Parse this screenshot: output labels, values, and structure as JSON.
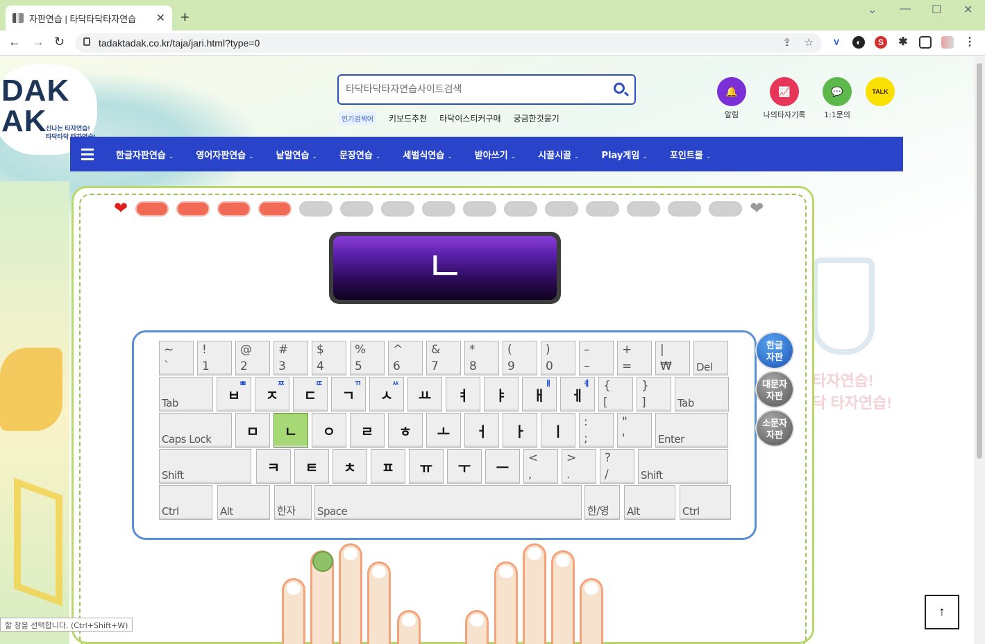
{
  "browser": {
    "tab_title": "자판연습 | 타닥타닥타자연습",
    "tab_close": "✕",
    "new_tab": "+",
    "url": "tadaktadak.co.kr/taja/jari.html?type=0",
    "back": "←",
    "forward": "→",
    "reload": "↻",
    "share": "⇪",
    "star": "☆",
    "menu": "⋮",
    "minimize": "⌄",
    "minimize2": "—",
    "maximize": "☐",
    "close": "✕"
  },
  "logo": {
    "text_top": "DAK",
    "text_bottom": "AK",
    "tagline_1": "신나는 타자연습!",
    "tagline_2": "타닥타닥 타자연습!"
  },
  "search": {
    "placeholder": "타닥타닥타자연습사이트검색"
  },
  "quick_links": {
    "hot": "인기검색어",
    "items": [
      "키보드추천",
      "타닥이스티커구매",
      "궁금한것묻기"
    ]
  },
  "top_icons": [
    {
      "label": "알림",
      "icon": "bell-icon",
      "color": "#7b2fd6"
    },
    {
      "label": "나의타자기록",
      "icon": "chart-icon",
      "color": "#e8355a"
    },
    {
      "label": "1:1문의",
      "icon": "chat-icon",
      "color": "#5cb84a"
    },
    {
      "label": "TALK",
      "icon": "kakao-talk-icon",
      "color": "#f9e000"
    }
  ],
  "gnb": {
    "items": [
      "한글자판연습",
      "영어자판연습",
      "낱말연습",
      "문장연습",
      "세벌식연습",
      "받아쓰기",
      "시끌시끌",
      "Play게임",
      "포인트몰"
    ],
    "caret": "⌄"
  },
  "progress": {
    "total": 15,
    "done": 4
  },
  "current_key": "ㄴ",
  "keyboard": {
    "row1": [
      {
        "t": "~",
        "b": "`"
      },
      {
        "t": "!",
        "b": "1"
      },
      {
        "t": "@",
        "b": "2"
      },
      {
        "t": "#",
        "b": "3"
      },
      {
        "t": "$",
        "b": "4"
      },
      {
        "t": "%",
        "b": "5"
      },
      {
        "t": "^",
        "b": "6"
      },
      {
        "t": "&",
        "b": "7"
      },
      {
        "t": "*",
        "b": "8"
      },
      {
        "t": "(",
        "b": "9"
      },
      {
        "t": ")",
        "b": "0"
      },
      {
        "t": "–",
        "b": "–"
      },
      {
        "t": "+",
        "b": "="
      },
      {
        "t": "|",
        "b": "₩"
      }
    ],
    "del": "Del",
    "tab": "Tab",
    "row2": [
      {
        "k": "ㅂ",
        "s": "ㅃ"
      },
      {
        "k": "ㅈ",
        "s": "ㅉ"
      },
      {
        "k": "ㄷ",
        "s": "ㄸ"
      },
      {
        "k": "ㄱ",
        "s": "ㄲ"
      },
      {
        "k": "ㅅ",
        "s": "ㅆ"
      },
      {
        "k": "ㅛ"
      },
      {
        "k": "ㅕ"
      },
      {
        "k": "ㅑ"
      },
      {
        "k": "ㅐ",
        "s": "ㅒ"
      },
      {
        "k": "ㅔ",
        "s": "ㅖ"
      }
    ],
    "row2_sym": [
      {
        "t": "{",
        "b": "["
      },
      {
        "t": "}",
        "b": "]"
      }
    ],
    "tab_right": "Tab",
    "caps": "Caps Lock",
    "row3": [
      "ㅁ",
      "ㄴ",
      "ㅇ",
      "ㄹ",
      "ㅎ",
      "ㅗ",
      "ㅓ",
      "ㅏ",
      "ㅣ"
    ],
    "row3_sym": [
      {
        "t": ":",
        "b": ";"
      },
      {
        "t": "\"",
        "b": "'"
      }
    ],
    "enter": "Enter",
    "shift": "Shift",
    "row4": [
      "ㅋ",
      "ㅌ",
      "ㅊ",
      "ㅍ",
      "ㅠ",
      "ㅜ",
      "ㅡ"
    ],
    "row4_sym": [
      {
        "t": "<",
        "b": ","
      },
      {
        "t": ">",
        "b": "."
      },
      {
        "t": "?",
        "b": "/"
      }
    ],
    "shift_right": "Shift",
    "ctrl": "Ctrl",
    "alt": "Alt",
    "hanja": "한자",
    "space": "Space",
    "hanyeong": "한/영",
    "alt_right": "Alt",
    "ctrl_right": "Ctrl",
    "target": "ㄴ"
  },
  "side_buttons": [
    {
      "label": "한글\n자판",
      "color": "#2f6fd1",
      "active": true
    },
    {
      "label": "대문자\n자판",
      "color": "#777777",
      "active": false
    },
    {
      "label": "소문자\n자판",
      "color": "#777777",
      "active": false
    }
  ],
  "side_copy": [
    "타자연습!",
    "닥 타자연습!"
  ],
  "status_tip": "할 창을 선택합니다. (Ctrl+Shift+W)",
  "totop": "↑"
}
